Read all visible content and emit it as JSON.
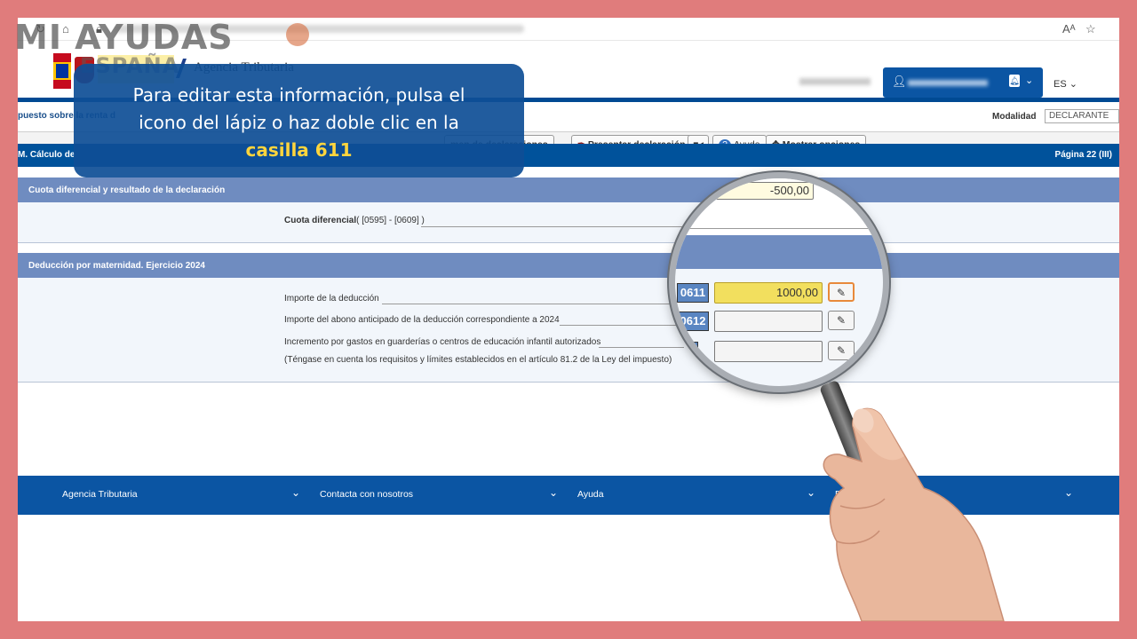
{
  "header": {
    "agency_name": "Agencia Tributaria",
    "language": "ES"
  },
  "watermark": {
    "line1": "MI AYUDAS",
    "line2": "ESPAÑA"
  },
  "subheader": {
    "breadcrumb": "puesto sobre la renta d",
    "modalidad_label": "Modalidad",
    "modalidad_value": "DECLARANTE"
  },
  "toolbar": {
    "resumen_label": "men de declaraciones",
    "presentar_label": "Presentar declaración",
    "ayuda_label": "Ayuda",
    "opciones_label": "Mostrar opciones"
  },
  "section": {
    "title": "M.  Cálculo de",
    "page": "Página 22 (III)"
  },
  "cuota": {
    "title": "Cuota diferencial y resultado de la declaración",
    "label_bold": "Cuota diferencial",
    "label_rest": "( [0595] - [0609] )",
    "value": "-500,00"
  },
  "deduccion": {
    "title": "Deducción por maternidad. Ejercicio 2024",
    "rows": [
      {
        "label": "Importe de la deducción",
        "casilla": "0611",
        "value": "1000,00"
      },
      {
        "label": "Importe del abono anticipado de la deducción correspondiente a 2024",
        "casilla": "0612",
        "value": ""
      },
      {
        "label": "Incremento por gastos en guarderías o centros de educación infantil autorizados",
        "casilla": "0613",
        "value": ""
      }
    ],
    "note": "(Téngase en cuenta los requisitos y límites establecidos en el artículo 81.2 de la Ley del impuesto)"
  },
  "footer": {
    "items": [
      "Agencia Tributaria",
      "Contacta con nosotros",
      "Ayuda",
      "En"
    ]
  },
  "banner": {
    "line1": "Para editar esta información, pulsa el",
    "line2": "icono del lápiz o haz doble clic en la",
    "highlight": "casilla 611"
  },
  "colors": {
    "frame": "#e07c7c",
    "primary": "#00529b",
    "subsection": "#6f8cc0",
    "highlight_field": "#f2df5e",
    "banner_highlight": "#ffd53d"
  }
}
